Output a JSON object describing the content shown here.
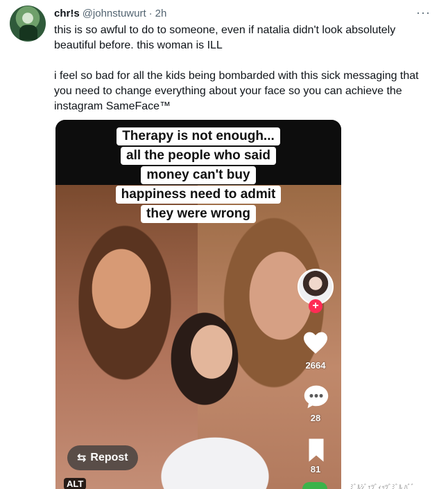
{
  "tweet": {
    "author_name": "chr!s",
    "author_handle": "@johnstuwurt",
    "separator": "·",
    "time": "2h",
    "more_glyph": "···",
    "paragraphs": [
      "this is so awful to do to someone, even if natalia didn't look absolutely beautiful before. this woman is ILL",
      "i feel so bad for all the kids being bombarded with this sick messaging that you need to change everything about your face so you can achieve the instagram SameFace™"
    ]
  },
  "media": {
    "caption_lines": [
      "Therapy is not enough...",
      "all the people who said",
      "money can't buy",
      "happiness need to admit",
      "they were wrong"
    ],
    "follow_glyph": "+",
    "likes_count": "2664",
    "comments_count": "28",
    "saves_count": "81",
    "repost_icon": "⇆",
    "repost_label": "Repost",
    "alt_label": "ALT",
    "music_text": "ﾐﾞﾙｼﾞｪﾂﾞｨｯﾂﾞﾐﾞﾙ ﾊﾞﾞ",
    "icons": {
      "heart": "heart-icon",
      "comment": "comment-icon",
      "bookmark": "bookmark-icon",
      "repost": "repost-icon"
    },
    "colors": {
      "follow_accent": "#fe2c55",
      "music_disc": "#3bb34a"
    }
  }
}
